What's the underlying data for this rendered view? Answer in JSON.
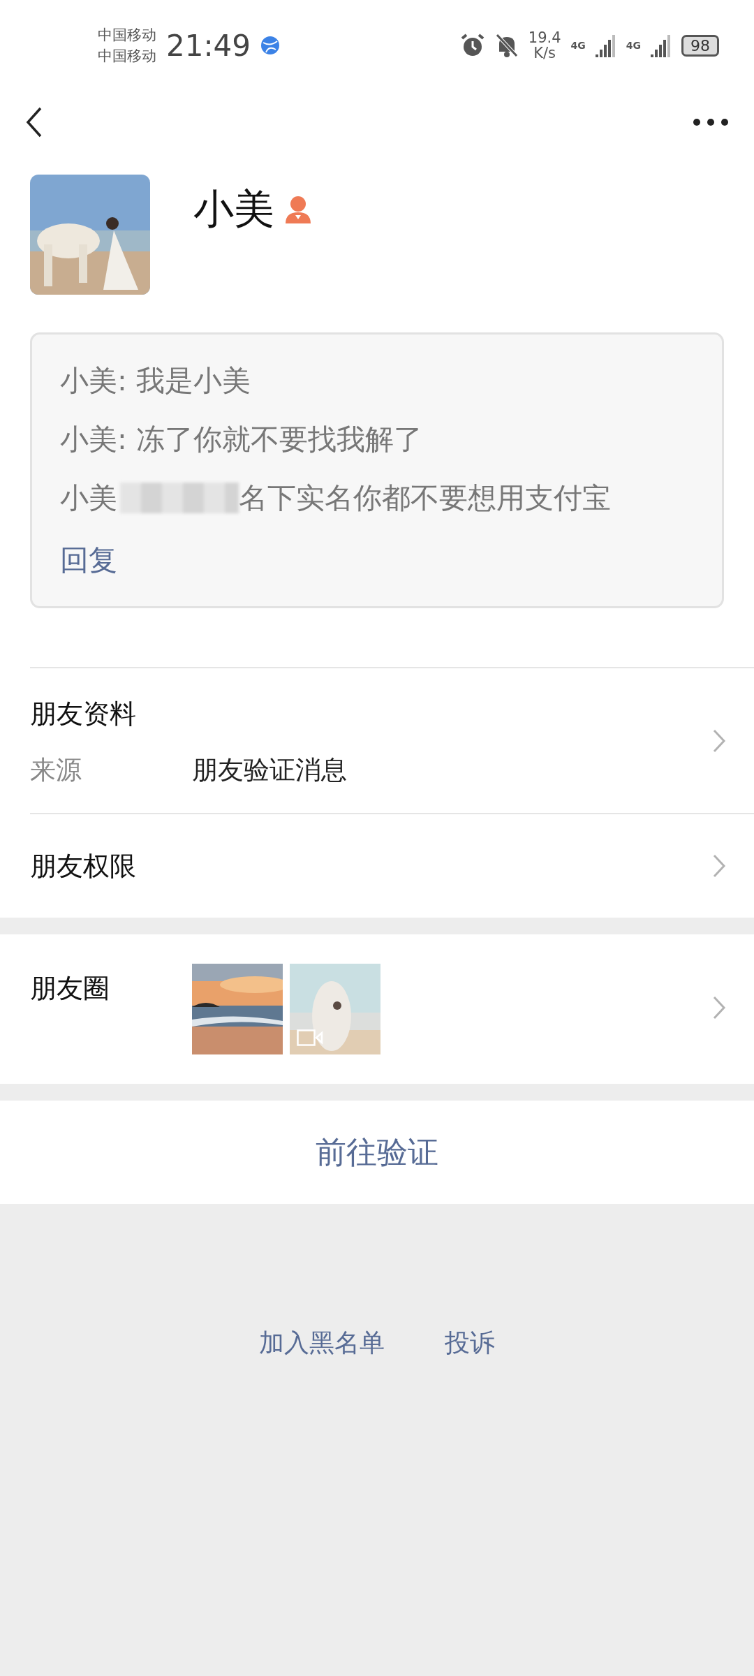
{
  "status_bar": {
    "carriers": [
      "中国移动",
      "中国移动"
    ],
    "time": "21:49",
    "speed_value": "19.4",
    "speed_unit": "K/s",
    "networks": [
      "4G",
      "4G"
    ],
    "battery": "98"
  },
  "profile": {
    "name": "小美"
  },
  "messages": [
    {
      "text": "小美: 我是小美",
      "redacted": false
    },
    {
      "text": "小美: 冻了你就不要找我解了",
      "redacted": false
    },
    {
      "sender": "小美",
      "text": "名下实名你都不要想用支付宝",
      "redacted": true
    }
  ],
  "reply_link": "回复",
  "friend_info": {
    "title": "朋友资料",
    "source_label": "来源",
    "source_value": "朋友验证消息"
  },
  "permissions": {
    "title": "朋友权限"
  },
  "moments": {
    "title": "朋友圈",
    "photos": [
      {
        "kind": "sunset"
      },
      {
        "kind": "video"
      }
    ]
  },
  "verify_button": "前往验证",
  "footer_links": [
    "加入黑名单",
    "投诉"
  ]
}
